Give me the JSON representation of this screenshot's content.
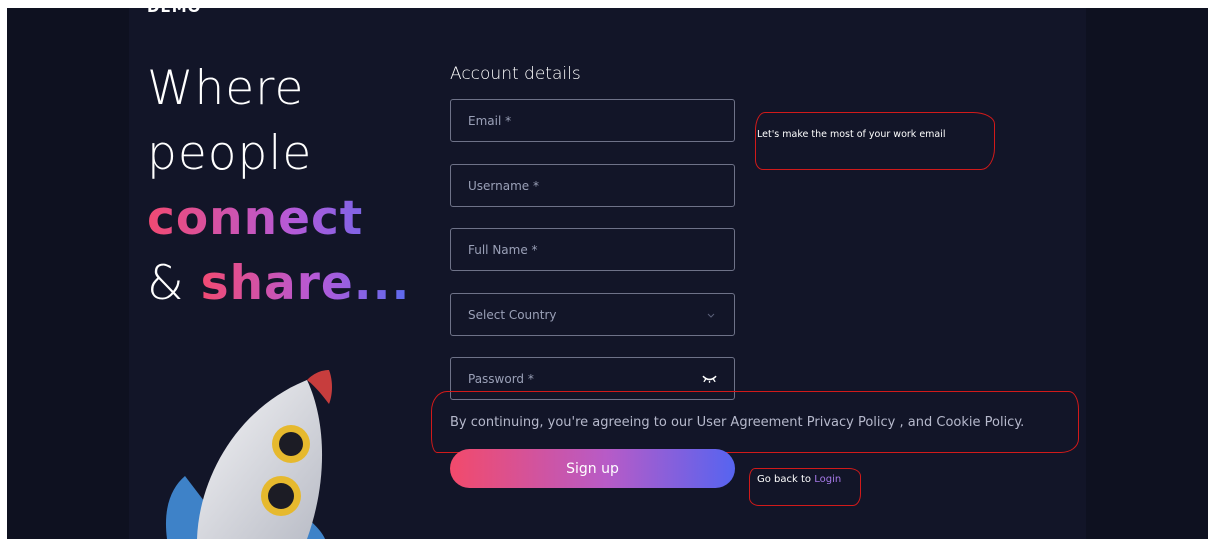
{
  "brand": {
    "name": "DEMO"
  },
  "hero": {
    "line1": "Where",
    "line2": "people",
    "line3": "connect",
    "line4_prefix": "& ",
    "line4_highlight": "share..."
  },
  "form": {
    "title": "Account details",
    "email_placeholder": "Email *",
    "email_hint": "Let's make the most of your work email",
    "username_placeholder": "Username *",
    "fullname_placeholder": "Full Name *",
    "country_placeholder": "Select Country",
    "password_placeholder": "Password *",
    "agreement": {
      "prefix": "By continuing, you're agreeing to our ",
      "user_agreement": "User Agreement",
      "privacy_policy": "Privacy Policy",
      "separator": ", and ",
      "cookie_policy": "Cookie Policy",
      "suffix": "."
    },
    "signup_label": "Sign up",
    "goback_prefix": "Go back to",
    "login_link": "Login"
  },
  "colors": {
    "background": "#111322",
    "panel": "#121528",
    "gradient_start": "#f24a6b",
    "gradient_mid": "#b75bc7",
    "gradient_end": "#5664f0",
    "annotation": "#d11a1a",
    "link": "#a679e8"
  },
  "icons": {
    "country_select": "chevron-down-icon",
    "password_toggle": "eye-closed-icon",
    "illustration": "rocket-illustration"
  }
}
